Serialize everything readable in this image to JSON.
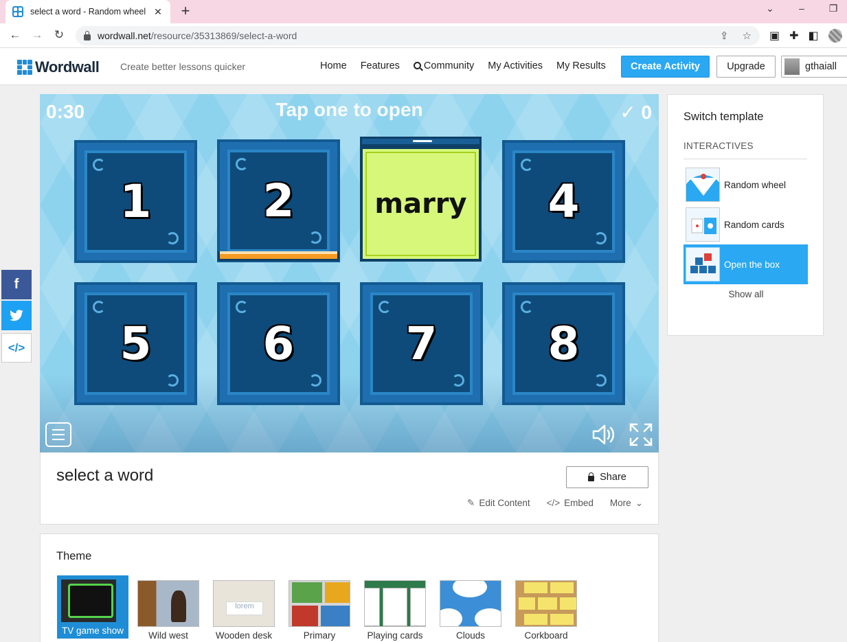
{
  "browser": {
    "tab_title": "select a word - Random wheel",
    "new_tab": "+",
    "close": "✕",
    "url_host": "wordwall.net",
    "url_path": "/resource/35313869/select-a-word"
  },
  "header": {
    "logo": "Wordwall",
    "tagline": "Create better lessons quicker",
    "nav": [
      "Home",
      "Features",
      "Community",
      "My Activities",
      "My Results"
    ],
    "create_btn": "Create Activity",
    "upgrade_btn": "Upgrade",
    "username": "gthaiall"
  },
  "game": {
    "timer": "0:30",
    "prompt": "Tap one to open",
    "score": "✓ 0",
    "boxes": [
      "1",
      "2",
      "4",
      "5",
      "6",
      "7",
      "8"
    ],
    "opened_word": "marry"
  },
  "activity": {
    "title": "select a word",
    "share": "Share",
    "links": [
      "Edit Content",
      "Embed",
      "More"
    ]
  },
  "theme": {
    "heading": "Theme",
    "items": [
      "TV game show",
      "Wild west",
      "Wooden desk",
      "Primary",
      "Playing cards",
      "Clouds",
      "Corkboard"
    ],
    "selected": "TV game show"
  },
  "panel": {
    "heading": "Switch template",
    "category": "INTERACTIVES",
    "templates": [
      "Random wheel",
      "Random cards",
      "Open the box"
    ],
    "selected": "Open the box",
    "show_all": "Show all"
  },
  "colors": {
    "accent": "#2aa8f2",
    "brand": "#1f8dd6",
    "game_bg": "#8ed3ee",
    "box": "#0e4b7a",
    "opened_card": "#d6f77a"
  }
}
